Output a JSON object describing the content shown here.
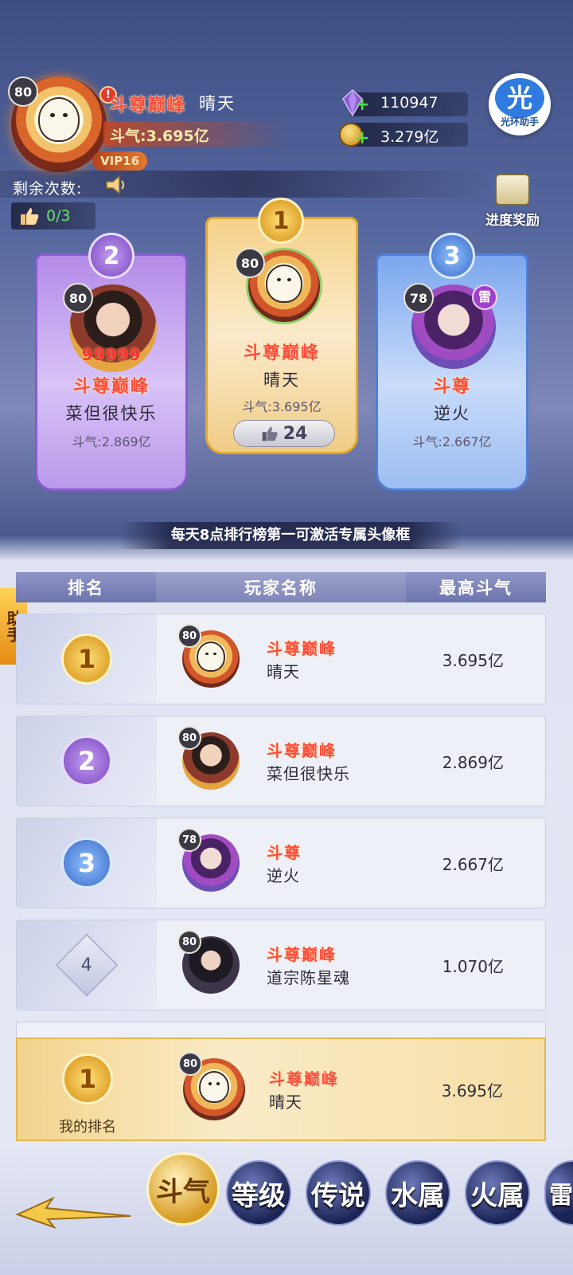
{
  "header": {
    "level": "80",
    "title": "斗尊巅峰",
    "name": "晴天",
    "power": "斗气:3.695亿",
    "vip": "VIP16",
    "alert": "!",
    "crystal": "110947",
    "gold": "3.279亿",
    "helper_char": "光",
    "helper_label": "光环助手",
    "remaining_label": "剩余次数:",
    "likes": "0/3",
    "reward_label": "进度奖励"
  },
  "podium": {
    "first": {
      "rank": "1",
      "level": "80",
      "title": "斗尊巅峰",
      "name": "晴天",
      "power": "斗气:3.695亿",
      "likes": "24"
    },
    "second": {
      "rank": "2",
      "level": "80",
      "badge": "99999",
      "title": "斗尊巅峰",
      "name": "菜但很快乐",
      "power": "斗气:2.869亿"
    },
    "third": {
      "rank": "3",
      "level": "78",
      "element": "雷",
      "title": "斗尊",
      "name": "逆火",
      "power": "斗气:2.667亿"
    }
  },
  "banner": "每天8点排行榜第一可激活专属头像框",
  "side_tab": "助手",
  "table": {
    "headers": [
      "排名",
      "玩家名称",
      "最高斗气"
    ],
    "rows": [
      {
        "rank": "1",
        "level": "80",
        "title": "斗尊巅峰",
        "name": "晴天",
        "value": "3.695亿"
      },
      {
        "rank": "2",
        "level": "80",
        "title": "斗尊巅峰",
        "name": "菜但很快乐",
        "value": "2.869亿"
      },
      {
        "rank": "3",
        "level": "78",
        "title": "斗尊",
        "name": "逆火",
        "value": "2.667亿"
      },
      {
        "rank": "4",
        "level": "80",
        "title": "斗尊巅峰",
        "name": "道宗陈星魂",
        "value": "1.070亿"
      }
    ]
  },
  "my_rank": {
    "label": "我的排名",
    "rank": "1",
    "level": "80",
    "title": "斗尊巅峰",
    "name": "晴天",
    "value": "3.695亿"
  },
  "tabs": [
    "斗气",
    "等级",
    "传说",
    "水属",
    "火属",
    "雷"
  ],
  "colors": {
    "title_red": "#ff4d3a",
    "gold": "#e2a92b",
    "purple": "#8a5ad0",
    "blue": "#4f7fd6"
  }
}
